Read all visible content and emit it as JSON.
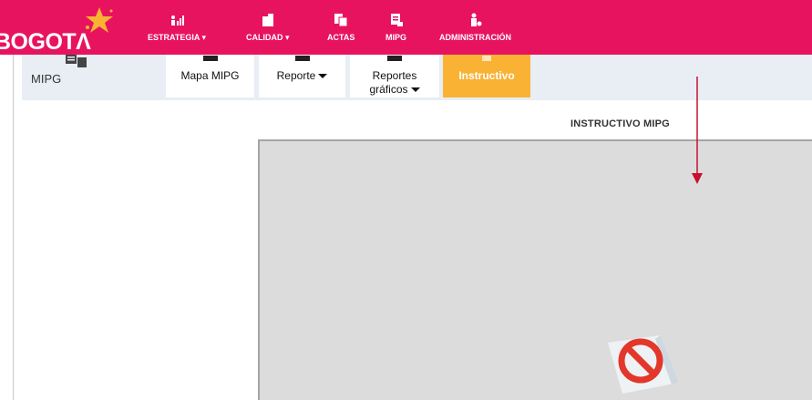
{
  "header": {
    "logo_text": "BOGOTΛ",
    "menu": [
      {
        "label": "ESTRATEGIA",
        "icon": "people-chart-icon",
        "has_dropdown": true
      },
      {
        "label": "CALIDAD",
        "icon": "document-icon",
        "has_dropdown": true
      },
      {
        "label": "ACTAS",
        "icon": "records-icon",
        "has_dropdown": false
      },
      {
        "label": "MIPG",
        "icon": "form-icon",
        "has_dropdown": false
      },
      {
        "label": "ADMINISTRACIÓN",
        "icon": "admin-user-icon",
        "has_dropdown": false
      }
    ],
    "colors": {
      "bar": "#e8135e",
      "text": "#ffffff"
    }
  },
  "section": {
    "label": "MIPG",
    "tabs": [
      {
        "line1": "Mapa MIPG",
        "line2": "",
        "has_dropdown": false,
        "active": false
      },
      {
        "line1": "Reporte",
        "line2": "",
        "has_dropdown": true,
        "active": false
      },
      {
        "line1": "Reportes",
        "line2": "gráficos",
        "has_dropdown": true,
        "active": false
      },
      {
        "line1": "Instructivo",
        "line2": "",
        "has_dropdown": false,
        "active": true
      }
    ],
    "colors": {
      "active_tab": "#f9b233",
      "bar": "#e8eef3"
    }
  },
  "content": {
    "title": "INSTRUCTIVO MIPG",
    "viewer_state": "blocked-content",
    "colors": {
      "viewer_bg": "#dcdcdc",
      "arrow": "#c8102e"
    }
  }
}
